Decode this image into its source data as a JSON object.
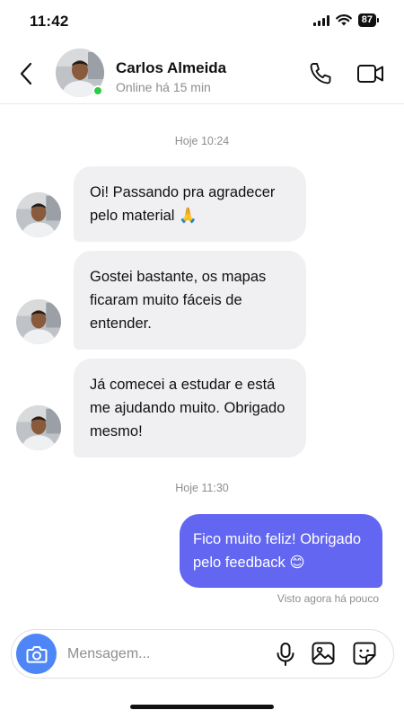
{
  "status_bar": {
    "time": "11:42",
    "battery": "87"
  },
  "header": {
    "contact_name": "Carlos Almeida",
    "contact_status": "Online há 15 min"
  },
  "messages": {
    "separator_1": "Hoje 10:24",
    "incoming": [
      "Oi! Passando pra agradecer pelo material 🙏",
      "Gostei bastante, os mapas ficaram muito fáceis de entender.",
      "Já comecei a estudar e está me ajudando muito. Obrigado mesmo!"
    ],
    "separator_2": "Hoje 11:30",
    "outgoing": "Fico muito feliz! Obrigado pelo feedback 😊",
    "seen_status": "Visto agora há pouco"
  },
  "composer": {
    "placeholder": "Mensagem..."
  },
  "colors": {
    "outgoing_bubble": "#6366f1",
    "incoming_bubble": "#f0f0f2",
    "camera_button": "#4f86f7",
    "online_indicator": "#2ecc40"
  },
  "icons": [
    "back-chevron-icon",
    "phone-icon",
    "video-camera-icon",
    "camera-icon",
    "microphone-icon",
    "image-icon",
    "sticker-icon"
  ]
}
